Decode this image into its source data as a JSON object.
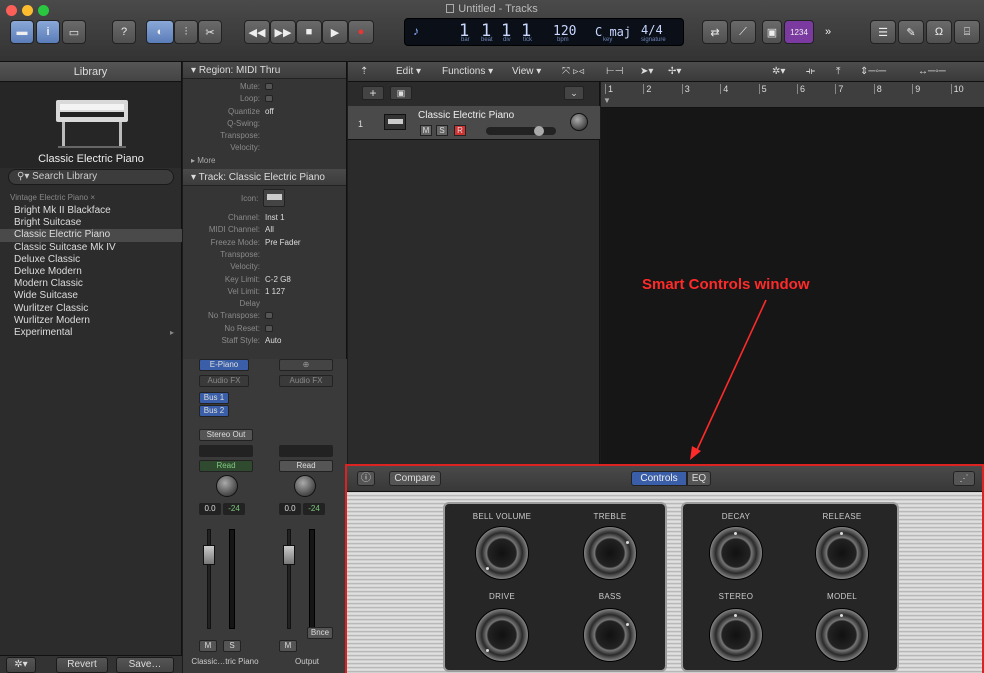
{
  "window": {
    "title": "Untitled - Tracks"
  },
  "control_bar": {
    "lcd": {
      "bar": "1",
      "beat": "1",
      "div": "1",
      "tick": "1",
      "bpm": "120",
      "key": "C maj",
      "signature": "4/4",
      "bar_label": "bar",
      "beat_label": "beat",
      "div_label": "div",
      "tick_label": "tick",
      "bpm_label": "bpm",
      "key_label": "key",
      "sig_label": "signature"
    },
    "count_in": "1234"
  },
  "library": {
    "header": "Library",
    "patch_name": "Classic Electric Piano",
    "search_placeholder": "Search Library",
    "breadcrumb": "Vintage Electric Piano",
    "items": [
      "Bright Mk II Blackface",
      "Bright Suitcase",
      "Classic Electric Piano",
      "Classic Suitcase Mk IV",
      "Deluxe Classic",
      "Deluxe Modern",
      "Modern Classic",
      "Wide Suitcase",
      "Wurlitzer Classic",
      "Wurlitzer Modern",
      "Experimental"
    ],
    "selected_index": 2,
    "revert": "Revert",
    "save": "Save…"
  },
  "inspector": {
    "region_header": "Region: MIDI Thru",
    "region_rows": [
      {
        "k": "Mute:",
        "v": ""
      },
      {
        "k": "Loop:",
        "v": ""
      },
      {
        "k": "Quantize",
        "v": "off"
      },
      {
        "k": "Q-Swing:",
        "v": ""
      },
      {
        "k": "Transpose:",
        "v": ""
      },
      {
        "k": "Velocity:",
        "v": ""
      }
    ],
    "more": "More",
    "track_header": "Track:  Classic Electric Piano",
    "icon_label": "Icon:",
    "track_rows": [
      {
        "k": "Channel:",
        "v": "Inst 1"
      },
      {
        "k": "MIDI Channel:",
        "v": "All"
      },
      {
        "k": "Freeze Mode:",
        "v": "Pre Fader"
      },
      {
        "k": "Transpose:",
        "v": ""
      },
      {
        "k": "Velocity:",
        "v": ""
      },
      {
        "k": "Key Limit:",
        "v": "C-2    G8"
      },
      {
        "k": "Vel Limit:",
        "v": "1    127"
      },
      {
        "k": "Delay",
        "v": ""
      },
      {
        "k": "No Transpose:",
        "v": ""
      },
      {
        "k": "No Reset:",
        "v": ""
      },
      {
        "k": "Staff Style:",
        "v": "Auto"
      }
    ],
    "strip1": {
      "instrument": "E-Piano",
      "audio_fx": "Audio FX",
      "bus1": "Bus 1",
      "bus2": "Bus 2",
      "output": "Stereo Out",
      "automation": "Read",
      "vol": "0.0",
      "peak": "-24",
      "m": "M",
      "s": "S",
      "name": "Classic…tric Piano"
    },
    "strip2": {
      "audio_fx": "Audio FX",
      "automation": "Read",
      "vol": "0.0",
      "peak": "-24",
      "bnce": "Bnce",
      "m": "M",
      "name": "Output"
    }
  },
  "tracks": {
    "menus": [
      "Edit",
      "Functions",
      "View"
    ],
    "track": {
      "number": "1",
      "name": "Classic Electric Piano",
      "m": "M",
      "s": "S",
      "r": "R"
    },
    "ruler": [
      "1",
      "2",
      "3",
      "4",
      "5",
      "6",
      "7",
      "8",
      "9",
      "10"
    ]
  },
  "annotation": "Smart Controls window",
  "smart_controls": {
    "compare": "Compare",
    "tabs": [
      "Controls",
      "EQ"
    ],
    "active_tab": "Controls",
    "knobs_left": [
      "BELL VOLUME",
      "TREBLE",
      "DRIVE",
      "BASS"
    ],
    "knobs_right": [
      "DECAY",
      "RELEASE",
      "STEREO",
      "MODEL"
    ]
  }
}
